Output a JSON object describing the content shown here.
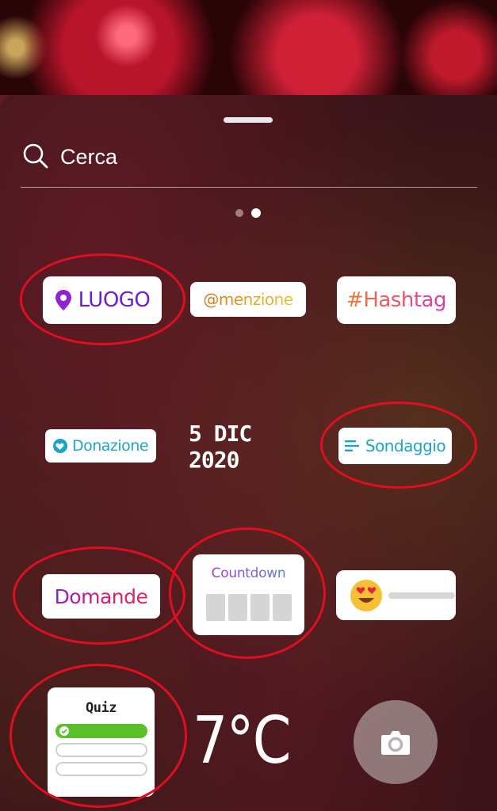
{
  "search": {
    "placeholder": "Cerca"
  },
  "pager": {
    "pages": 2,
    "current": 2
  },
  "stickers": {
    "luogo": "LUOGO",
    "menzione": "@menzione",
    "hashtag": "#Hashtag",
    "donazione": "Donazione",
    "date": "5 DIC 2020",
    "sondaggio": "Sondaggio",
    "domande": "Domande",
    "countdown": "Countdown",
    "quiz": "Quiz",
    "temperature": "7°C"
  },
  "icons": {
    "search": "search-icon",
    "location": "location-pin-icon",
    "donation": "heart-icon",
    "poll": "list-lines-icon",
    "emoji": "heart-eyes-emoji-icon",
    "check": "check-icon",
    "camera": "camera-icon"
  },
  "colors": {
    "luogo": "#6b1fd6",
    "donazione": "#1aa5c8",
    "quiz_correct": "#5bbf2a",
    "annotation": "#e00e1e"
  }
}
